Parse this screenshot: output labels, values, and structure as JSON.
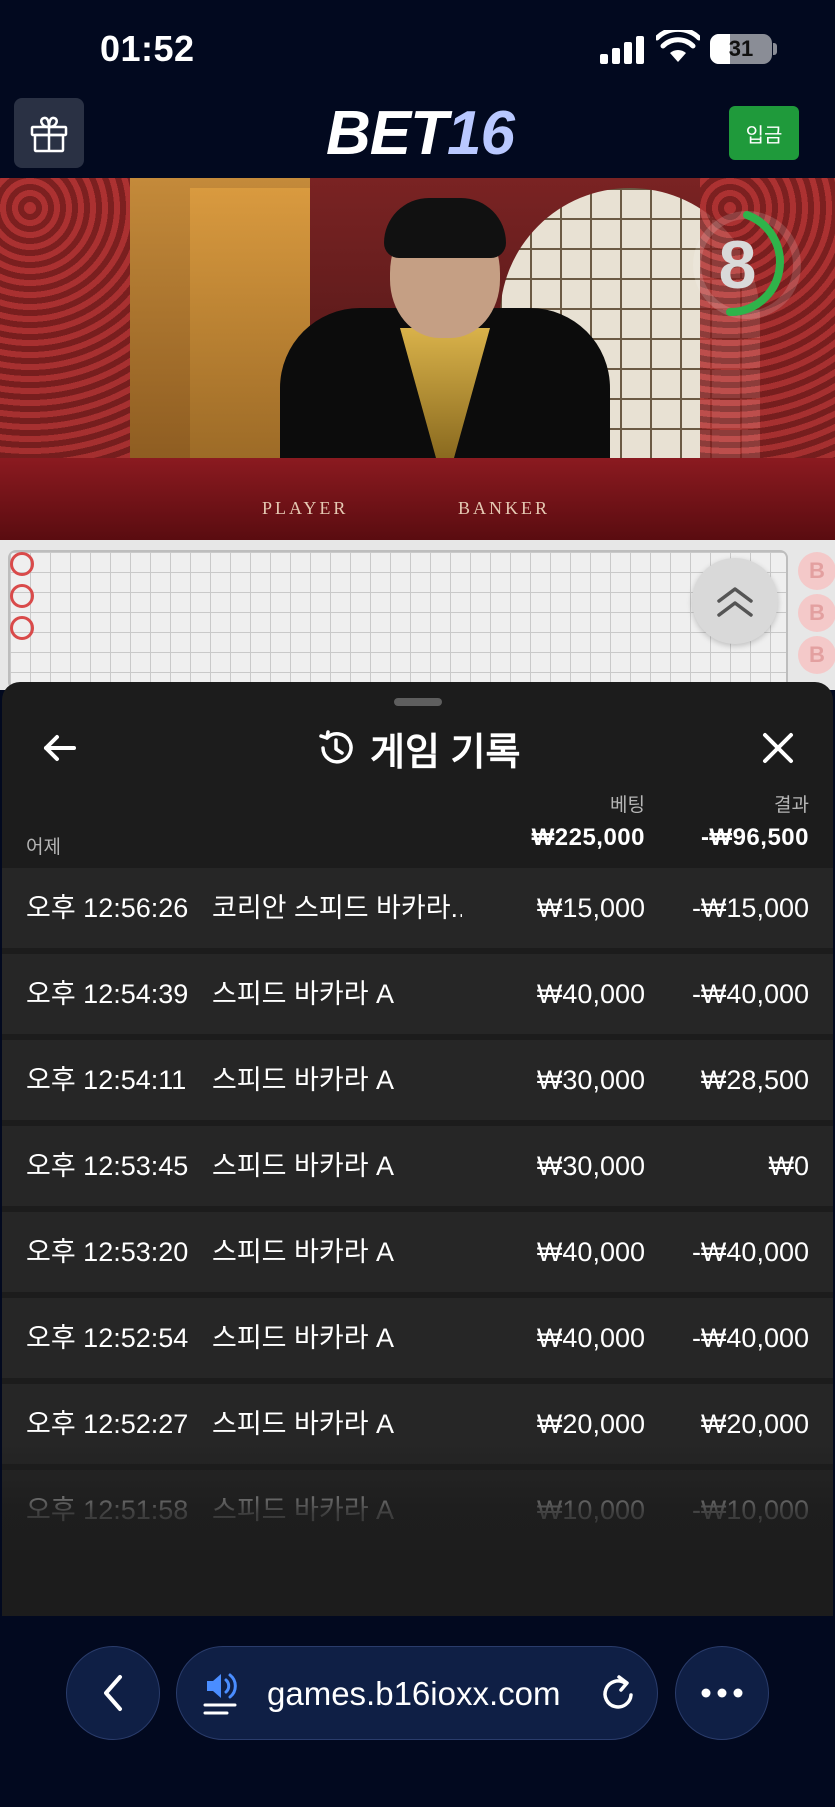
{
  "status_bar": {
    "time": "01:52",
    "battery": "31"
  },
  "header": {
    "brand_main": "BET",
    "brand_num": "16",
    "deposit_label": "입금"
  },
  "video": {
    "timer": "8",
    "player_label": "PLAYER",
    "banker_label": "BANKER"
  },
  "roadmap": {
    "banker_marks": [
      "B",
      "B",
      "B"
    ]
  },
  "history": {
    "title": "게임 기록",
    "col_bet": "베팅",
    "col_result": "결과",
    "day": "어제",
    "total_bet": "₩225,000",
    "total_result": "-₩96,500",
    "rows": [
      {
        "time": "오후 12:56:26",
        "game": "코리안 스피드 바카라...",
        "bet": "₩15,000",
        "result": "-₩15,000"
      },
      {
        "time": "오후 12:54:39",
        "game": "스피드 바카라 A",
        "bet": "₩40,000",
        "result": "-₩40,000"
      },
      {
        "time": "오후 12:54:11",
        "game": "스피드 바카라 A",
        "bet": "₩30,000",
        "result": "₩28,500"
      },
      {
        "time": "오후 12:53:45",
        "game": "스피드 바카라 A",
        "bet": "₩30,000",
        "result": "₩0"
      },
      {
        "time": "오후 12:53:20",
        "game": "스피드 바카라 A",
        "bet": "₩40,000",
        "result": "-₩40,000"
      },
      {
        "time": "오후 12:52:54",
        "game": "스피드 바카라 A",
        "bet": "₩40,000",
        "result": "-₩40,000"
      },
      {
        "time": "오후 12:52:27",
        "game": "스피드 바카라 A",
        "bet": "₩20,000",
        "result": "₩20,000"
      },
      {
        "time": "오후 12:51:58",
        "game": "스피드 바카라 A",
        "bet": "₩10,000",
        "result": "-₩10,000"
      }
    ]
  },
  "browser": {
    "url": "games.b16ioxx.com"
  },
  "icons": [
    "gift-icon",
    "chevron-up-double-icon",
    "history-icon",
    "arrow-left-icon",
    "close-icon",
    "chevron-left-icon",
    "speaker-icon",
    "reload-icon",
    "more-icon"
  ],
  "colors": {
    "background": "#02091f",
    "deposit": "#1f9a3b",
    "timer_ring": "#2fb34a",
    "sheet": "#1c1c1c",
    "row": "#262626"
  }
}
